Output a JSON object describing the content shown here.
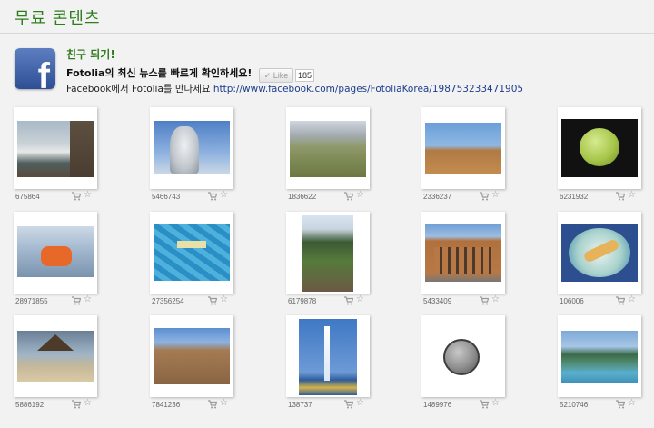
{
  "header": {
    "title": "무료 콘텐츠"
  },
  "promo": {
    "logo_letter": "f",
    "heading": "친구 되기!",
    "message": "Fotolia의 최신 뉴스를 빠르게 확인하세요!",
    "like_label": "✓ Like",
    "like_count": "185",
    "sub_prefix": "Facebook에서 Fotolia를 만나세요 ",
    "sub_link": "http://www.facebook.com/pages/FotoliaKorea/198753233471905"
  },
  "thumbnails": [
    {
      "id": "675864",
      "icon": "cart-icon"
    },
    {
      "id": "5466743",
      "icon": "cart-icon"
    },
    {
      "id": "1836622",
      "icon": "cart-icon"
    },
    {
      "id": "2336237",
      "icon": "cart-icon"
    },
    {
      "id": "6231932",
      "icon": "cart-icon"
    },
    {
      "id": "28971855",
      "icon": "cart-icon"
    },
    {
      "id": "27356254",
      "icon": "cart-icon"
    },
    {
      "id": "6179878",
      "icon": "cart-icon"
    },
    {
      "id": "5433409",
      "icon": "cart-icon"
    },
    {
      "id": "106006",
      "icon": "cart-icon"
    },
    {
      "id": "5886192",
      "icon": "cart-icon"
    },
    {
      "id": "7841236",
      "icon": "cart-icon"
    },
    {
      "id": "138737",
      "icon": "cart-icon"
    },
    {
      "id": "1489976",
      "icon": "cart-icon"
    },
    {
      "id": "5210746",
      "icon": "cart-icon"
    }
  ],
  "thumbnail_icon": "star-icon"
}
